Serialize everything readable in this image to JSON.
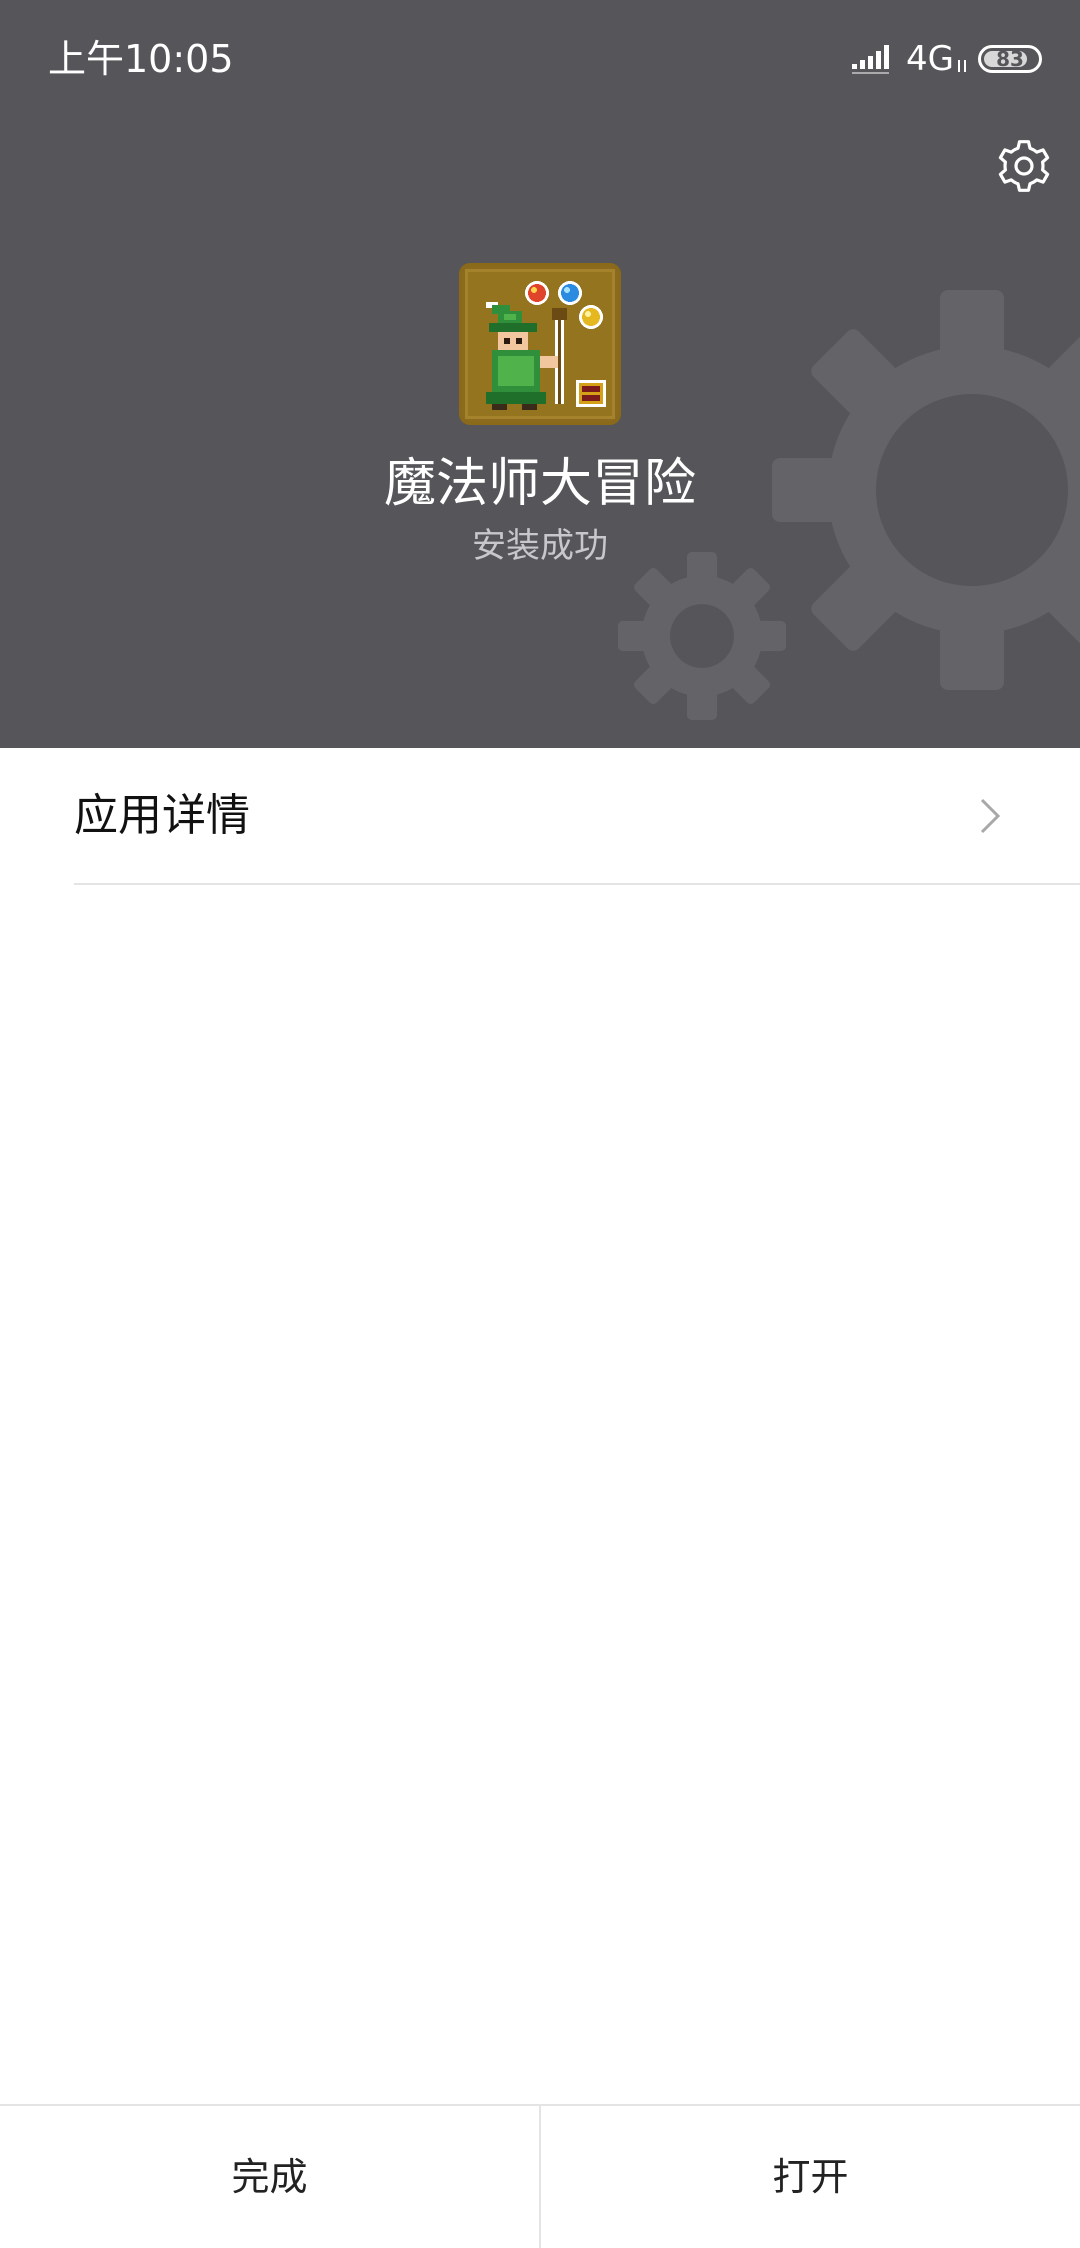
{
  "status_bar": {
    "time": "上午10:05",
    "network": "4G",
    "battery": "83",
    "battery_level": 0.83
  },
  "header": {
    "settings_icon": "gear-icon",
    "background_color": "#55555a",
    "app_icon": "wizard-app-icon",
    "app_name": "魔法师大冒险",
    "install_status": "安装成功"
  },
  "details": {
    "label": "应用详情",
    "chevron_icon": "chevron-right-icon"
  },
  "footer": {
    "done_label": "完成",
    "open_label": "打开"
  }
}
